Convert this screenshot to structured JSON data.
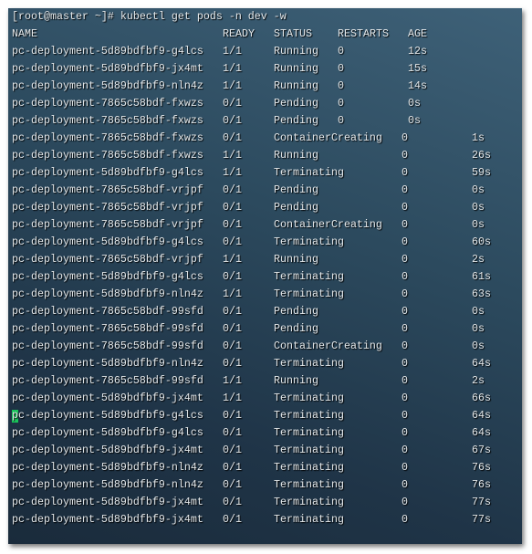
{
  "terminal": {
    "prompt": "[root@master ~]# kubectl get pods -n dev -w",
    "headers": [
      "NAME",
      "READY",
      "STATUS",
      "RESTARTS",
      "AGE"
    ],
    "cursor_color": "#19c35a",
    "rows": [
      {
        "name": "pc-deployment-5d89bdfbf9-g4lcs",
        "ready": "1/1",
        "status": "Running",
        "restarts": "0",
        "age": "12s",
        "wide": false
      },
      {
        "name": "pc-deployment-5d89bdfbf9-jx4mt",
        "ready": "1/1",
        "status": "Running",
        "restarts": "0",
        "age": "15s",
        "wide": false
      },
      {
        "name": "pc-deployment-5d89bdfbf9-nln4z",
        "ready": "1/1",
        "status": "Running",
        "restarts": "0",
        "age": "14s",
        "wide": false
      },
      {
        "name": "pc-deployment-7865c58bdf-fxwzs",
        "ready": "0/1",
        "status": "Pending",
        "restarts": "0",
        "age": "0s",
        "wide": false
      },
      {
        "name": "pc-deployment-7865c58bdf-fxwzs",
        "ready": "0/1",
        "status": "Pending",
        "restarts": "0",
        "age": "0s",
        "wide": false
      },
      {
        "name": "pc-deployment-7865c58bdf-fxwzs",
        "ready": "0/1",
        "status": "ContainerCreating",
        "restarts": "0",
        "age": "1s",
        "wide": true
      },
      {
        "name": "pc-deployment-7865c58bdf-fxwzs",
        "ready": "1/1",
        "status": "Running",
        "restarts": "0",
        "age": "26s",
        "wide": true
      },
      {
        "name": "pc-deployment-5d89bdfbf9-g4lcs",
        "ready": "1/1",
        "status": "Terminating",
        "restarts": "0",
        "age": "59s",
        "wide": true
      },
      {
        "name": "pc-deployment-7865c58bdf-vrjpf",
        "ready": "0/1",
        "status": "Pending",
        "restarts": "0",
        "age": "0s",
        "wide": true
      },
      {
        "name": "pc-deployment-7865c58bdf-vrjpf",
        "ready": "0/1",
        "status": "Pending",
        "restarts": "0",
        "age": "0s",
        "wide": true
      },
      {
        "name": "pc-deployment-7865c58bdf-vrjpf",
        "ready": "0/1",
        "status": "ContainerCreating",
        "restarts": "0",
        "age": "0s",
        "wide": true
      },
      {
        "name": "pc-deployment-5d89bdfbf9-g4lcs",
        "ready": "0/1",
        "status": "Terminating",
        "restarts": "0",
        "age": "60s",
        "wide": true
      },
      {
        "name": "pc-deployment-7865c58bdf-vrjpf",
        "ready": "1/1",
        "status": "Running",
        "restarts": "0",
        "age": "2s",
        "wide": true
      },
      {
        "name": "pc-deployment-5d89bdfbf9-g4lcs",
        "ready": "0/1",
        "status": "Terminating",
        "restarts": "0",
        "age": "61s",
        "wide": true
      },
      {
        "name": "pc-deployment-5d89bdfbf9-nln4z",
        "ready": "1/1",
        "status": "Terminating",
        "restarts": "0",
        "age": "63s",
        "wide": true
      },
      {
        "name": "pc-deployment-7865c58bdf-99sfd",
        "ready": "0/1",
        "status": "Pending",
        "restarts": "0",
        "age": "0s",
        "wide": true
      },
      {
        "name": "pc-deployment-7865c58bdf-99sfd",
        "ready": "0/1",
        "status": "Pending",
        "restarts": "0",
        "age": "0s",
        "wide": true
      },
      {
        "name": "pc-deployment-7865c58bdf-99sfd",
        "ready": "0/1",
        "status": "ContainerCreating",
        "restarts": "0",
        "age": "0s",
        "wide": true
      },
      {
        "name": "pc-deployment-5d89bdfbf9-nln4z",
        "ready": "0/1",
        "status": "Terminating",
        "restarts": "0",
        "age": "64s",
        "wide": true
      },
      {
        "name": "pc-deployment-7865c58bdf-99sfd",
        "ready": "1/1",
        "status": "Running",
        "restarts": "0",
        "age": "2s",
        "wide": true
      },
      {
        "name": "pc-deployment-5d89bdfbf9-jx4mt",
        "ready": "1/1",
        "status": "Terminating",
        "restarts": "0",
        "age": "66s",
        "wide": true
      },
      {
        "name": "pc-deployment-5d89bdfbf9-g4lcs",
        "ready": "0/1",
        "status": "Terminating",
        "restarts": "0",
        "age": "64s",
        "wide": true,
        "cursor": true
      },
      {
        "name": "pc-deployment-5d89bdfbf9-g4lcs",
        "ready": "0/1",
        "status": "Terminating",
        "restarts": "0",
        "age": "64s",
        "wide": true
      },
      {
        "name": "pc-deployment-5d89bdfbf9-jx4mt",
        "ready": "0/1",
        "status": "Terminating",
        "restarts": "0",
        "age": "67s",
        "wide": true
      },
      {
        "name": "pc-deployment-5d89bdfbf9-nln4z",
        "ready": "0/1",
        "status": "Terminating",
        "restarts": "0",
        "age": "76s",
        "wide": true
      },
      {
        "name": "pc-deployment-5d89bdfbf9-nln4z",
        "ready": "0/1",
        "status": "Terminating",
        "restarts": "0",
        "age": "76s",
        "wide": true
      },
      {
        "name": "pc-deployment-5d89bdfbf9-jx4mt",
        "ready": "0/1",
        "status": "Terminating",
        "restarts": "0",
        "age": "77s",
        "wide": true
      },
      {
        "name": "pc-deployment-5d89bdfbf9-jx4mt",
        "ready": "0/1",
        "status": "Terminating",
        "restarts": "0",
        "age": "77s",
        "wide": true
      }
    ]
  }
}
